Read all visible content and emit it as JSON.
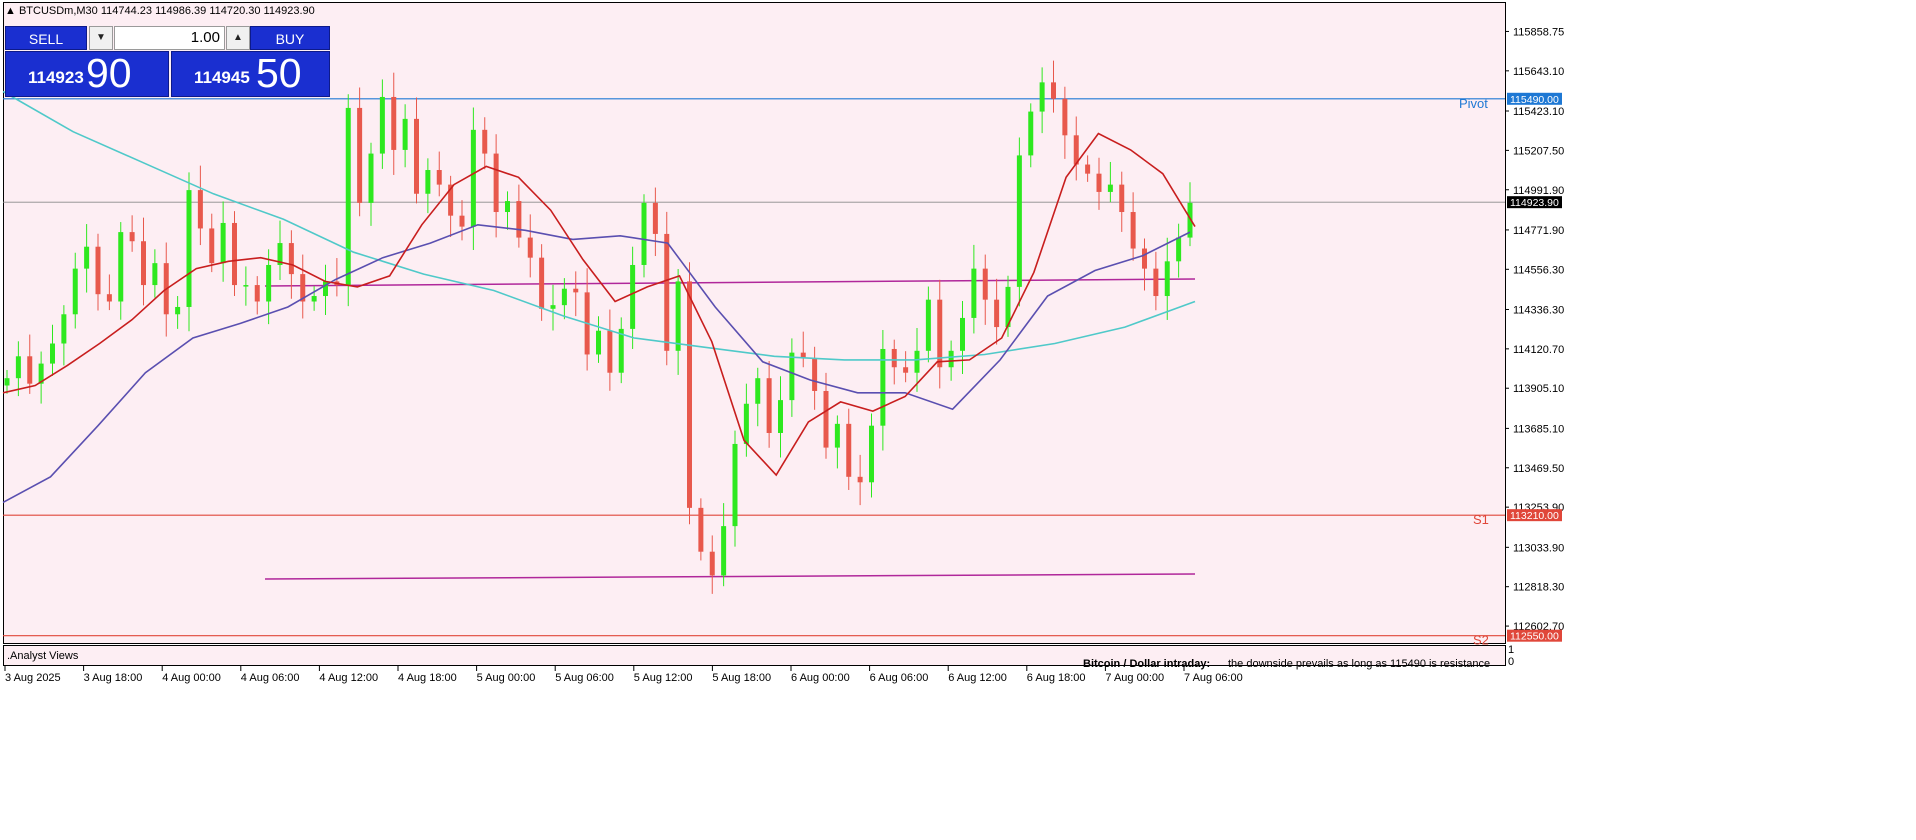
{
  "header": {
    "info": "BTCUSDm,M30  114744.23 114986.39 114720.30 114923.90"
  },
  "trade_panel": {
    "sell_label": "SELL",
    "buy_label": "BUY",
    "volume": "1.00",
    "sell_price_small": "114923",
    "sell_price_big": "90",
    "buy_price_small": "114945",
    "buy_price_big": "50"
  },
  "chart_data": {
    "type": "candlestick",
    "symbol": "BTCUSDm",
    "timeframe": "M30",
    "ylim": [
      112510,
      116020
    ],
    "y_ticks": [
      "115858.75",
      "115643.10",
      "115423.10",
      "115207.50",
      "114991.90",
      "114771.90",
      "114556.30",
      "114336.30",
      "114120.70",
      "113905.10",
      "113685.10",
      "113469.50",
      "113253.90",
      "113033.90",
      "112818.30",
      "112602.70"
    ],
    "x_ticks": [
      "3 Aug 2025",
      "3 Aug 18:00",
      "4 Aug 00:00",
      "4 Aug 06:00",
      "4 Aug 12:00",
      "4 Aug 18:00",
      "5 Aug 00:00",
      "5 Aug 06:00",
      "5 Aug 12:00",
      "5 Aug 18:00",
      "6 Aug 00:00",
      "6 Aug 06:00",
      "6 Aug 12:00",
      "6 Aug 18:00",
      "7 Aug 00:00",
      "7 Aug 06:00"
    ],
    "levels": [
      {
        "name": "Pivot",
        "value": 115490.0,
        "label": "115490.00",
        "color": "#1e78d4"
      },
      {
        "name": "S1",
        "value": 113210.0,
        "label": "113210.00",
        "color": "#e0473a"
      },
      {
        "name": "S2",
        "value": 112550.0,
        "label": "112550.00",
        "color": "#e0473a"
      }
    ],
    "current_price": {
      "value": 114923.9,
      "label": "114923.90"
    },
    "candles_close_path": [
      113960,
      114080,
      113930,
      114040,
      114150,
      114310,
      114560,
      114680,
      114420,
      114380,
      114760,
      114710,
      114470,
      114590,
      114310,
      114350,
      114990,
      114780,
      114590,
      114810,
      114470,
      114470,
      114380,
      114580,
      114700,
      114530,
      114380,
      114410,
      114490,
      114470,
      115440,
      114920,
      115190,
      115500,
      115210,
      115380,
      114970,
      115100,
      115020,
      114850,
      114790,
      115320,
      115190,
      114870,
      114930,
      114730,
      114620,
      114340,
      114360,
      114450,
      114430,
      114090,
      114220,
      113990,
      114230,
      114580,
      114920,
      114750,
      114110,
      114490,
      113250,
      113010,
      112880,
      113150,
      113600,
      113820,
      113960,
      113660,
      113840,
      114100,
      114070,
      113890,
      113580,
      113710,
      113420,
      113390,
      113700,
      114120,
      114020,
      113990,
      114110,
      114390,
      114020,
      114110,
      114290,
      114560,
      114390,
      114240,
      114460,
      115180,
      115420,
      115580,
      115490,
      115290,
      115130,
      115080,
      114980,
      115020,
      114870,
      114670,
      114560,
      114410,
      114600,
      114730,
      114920
    ],
    "ma_red_path": [
      113880,
      113920,
      114030,
      114150,
      114280,
      114440,
      114560,
      114600,
      114620,
      114580,
      114490,
      114460,
      114520,
      114800,
      115020,
      115120,
      115060,
      114880,
      114610,
      114380,
      114460,
      114520,
      114160,
      113620,
      113430,
      113720,
      113830,
      113780,
      113860,
      114050,
      114060,
      114180,
      114540,
      115060,
      115300,
      115210,
      115080,
      114790
    ],
    "ma_blue_path": [
      113280,
      113420,
      113700,
      113990,
      114180,
      114260,
      114350,
      114500,
      114620,
      114700,
      114800,
      114770,
      114720,
      114740,
      114700,
      114350,
      114050,
      113950,
      113880,
      113880,
      113790,
      114060,
      114410,
      114550,
      114630,
      114760
    ],
    "ma_cyan_path": [
      115530,
      115310,
      115140,
      114970,
      114830,
      114650,
      114530,
      114440,
      114300,
      114180,
      114130,
      114080,
      114060,
      114060,
      114090,
      114150,
      114240,
      114380
    ],
    "analyst_box_title": "Bitcoin / Dollar intraday:",
    "analyst_box_text": "the downside prevails as long as 115490 is resistance",
    "indicator_label": ".Analyst Views",
    "subwindow_ticks": [
      "1",
      "0"
    ]
  }
}
